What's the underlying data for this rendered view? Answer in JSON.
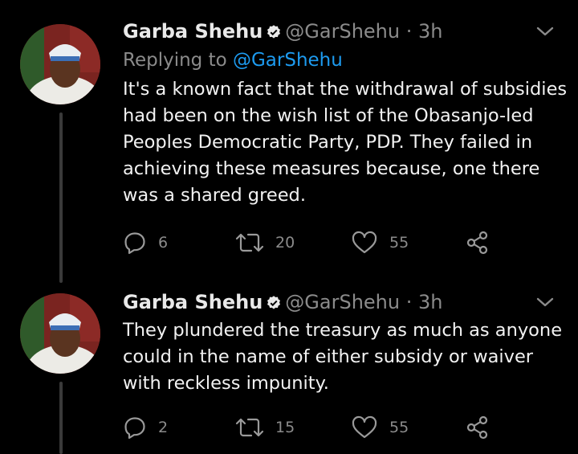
{
  "tweets": [
    {
      "author_name": "Garba Shehu",
      "handle": "@GarShehu",
      "separator": "·",
      "time": "3h",
      "replying_prefix": "Replying to",
      "replying_to": "@GarShehu",
      "text": "It's a known fact that the withdrawal of subsidies had been on the wish list of the Obasanjo-led Peoples Democratic Party, PDP. They failed in achieving these measures because, one there was a shared greed.",
      "replies": "6",
      "retweets": "20",
      "likes": "55"
    },
    {
      "author_name": "Garba Shehu",
      "handle": "@GarShehu",
      "separator": "·",
      "time": "3h",
      "text": "They plundered the treasury as much as anyone could in the name of either subsidy or waiver with reckless impunity.",
      "replies": "2",
      "retweets": "15",
      "likes": "55"
    }
  ],
  "colors": {
    "background": "#000000",
    "muted": "#8b8b8b",
    "link": "#1d9bf0",
    "thread_line": "#3a3a3a"
  },
  "icons": [
    "verified-badge-icon",
    "chevron-down-icon",
    "reply-icon",
    "retweet-icon",
    "like-icon",
    "share-icon"
  ]
}
